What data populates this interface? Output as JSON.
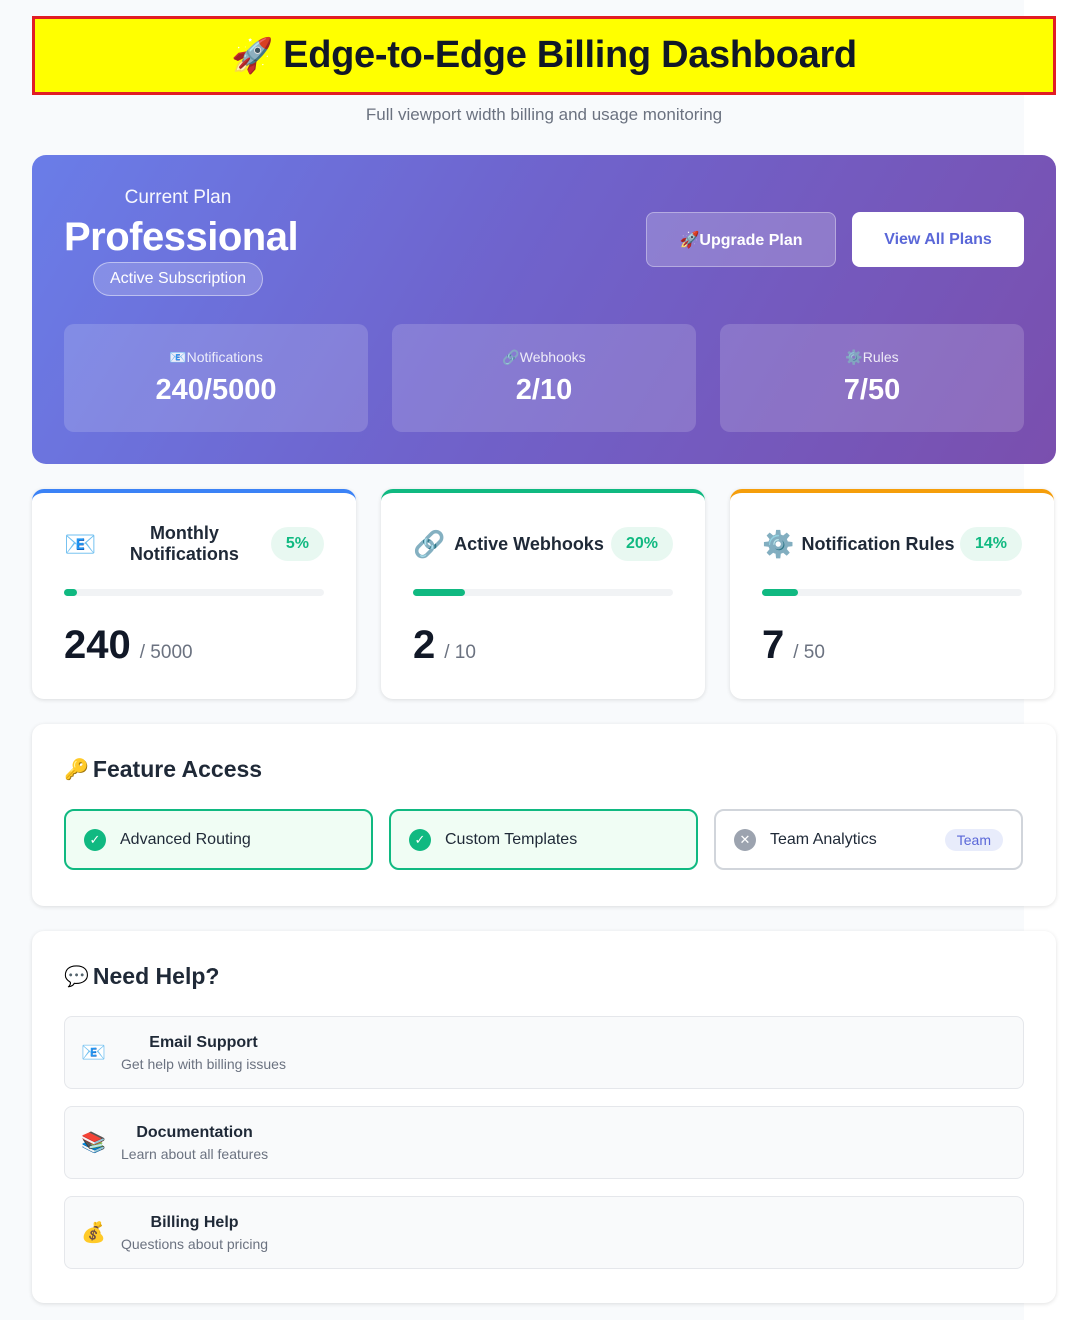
{
  "header": {
    "icon": "rocket-icon",
    "title": "Edge-to-Edge Billing Dashboard",
    "subtitle": "Full viewport width billing and usage monitoring"
  },
  "plan": {
    "label": "Current Plan",
    "name": "Professional",
    "status": "Active Subscription",
    "upgrade_label": "🚀Upgrade Plan",
    "view_label": "View All Plans",
    "stats": [
      {
        "icon": "email-icon",
        "label": "📧Notifications",
        "value": "240/5000"
      },
      {
        "icon": "link-icon",
        "label": "🔗Webhooks",
        "value": "2/10"
      },
      {
        "icon": "gear-icon",
        "label": "⚙️Rules",
        "value": "7/50"
      }
    ]
  },
  "usage": [
    {
      "icon": "📧",
      "title": "Monthly Notifications",
      "percent_label": "5%",
      "percent": 5,
      "used": "240",
      "max": "/ 5000",
      "accent": "#3b82f6"
    },
    {
      "icon": "🔗",
      "title": "Active Webhooks",
      "percent_label": "20%",
      "percent": 20,
      "used": "2",
      "max": "/ 10",
      "accent": "#10b981"
    },
    {
      "icon": "⚙️",
      "title": "Notification Rules",
      "percent_label": "14%",
      "percent": 14,
      "used": "7",
      "max": "/ 50",
      "accent": "#f59e0b"
    }
  ],
  "features": {
    "icon": "🔑",
    "title": "Feature Access",
    "items": [
      {
        "label": "Advanced Routing",
        "enabled": true,
        "mark": "✓"
      },
      {
        "label": "Custom Templates",
        "enabled": true,
        "mark": "✓"
      },
      {
        "label": "Team Analytics",
        "enabled": false,
        "mark": "✕",
        "tier": "Team"
      }
    ]
  },
  "help": {
    "icon": "💬",
    "title": "Need Help?",
    "items": [
      {
        "icon": "📧",
        "title": "Email Support",
        "desc": "Get help with billing issues"
      },
      {
        "icon": "📚",
        "title": "Documentation",
        "desc": "Learn about all features"
      },
      {
        "icon": "💰",
        "title": "Billing Help",
        "desc": "Questions about pricing"
      }
    ]
  },
  "colors": {
    "success": "#10b981",
    "brand": "#5a67d8",
    "banner": "#ffff00",
    "banner_border": "#e11d24"
  }
}
